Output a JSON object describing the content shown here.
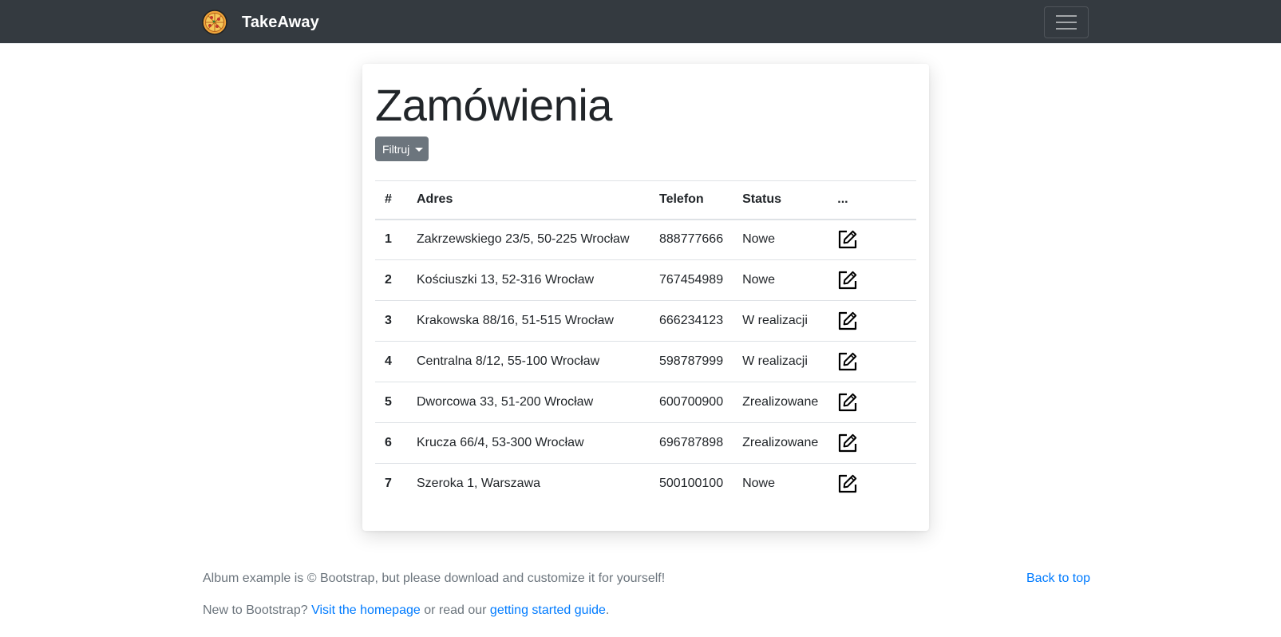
{
  "navbar": {
    "brand_name": "TakeAway",
    "logo_icon": "pizza-icon",
    "menu_icon": "hamburger-icon"
  },
  "main": {
    "title": "Zamówienia",
    "filter_button_label": "Filtruj",
    "table": {
      "headers": [
        "#",
        "Adres",
        "Telefon",
        "Status",
        "..."
      ],
      "rows": [
        {
          "num": "1",
          "address": "Zakrzewskiego 23/5, 50-225 Wrocław",
          "phone": "888777666",
          "status": "Nowe"
        },
        {
          "num": "2",
          "address": "Kościuszki 13, 52-316 Wrocław",
          "phone": "767454989",
          "status": "Nowe"
        },
        {
          "num": "3",
          "address": "Krakowska 88/16, 51-515 Wrocław",
          "phone": "666234123",
          "status": "W realizacji"
        },
        {
          "num": "4",
          "address": "Centralna 8/12, 55-100 Wrocław",
          "phone": "598787999",
          "status": "W realizacji"
        },
        {
          "num": "5",
          "address": "Dworcowa 33, 51-200 Wrocław",
          "phone": "600700900",
          "status": "Zrealizowane"
        },
        {
          "num": "6",
          "address": "Krucza 66/4, 53-300 Wrocław",
          "phone": "696787898",
          "status": "Zrealizowane"
        },
        {
          "num": "7",
          "address": "Szeroka 1, Warszawa",
          "phone": "500100100",
          "status": "Nowe"
        }
      ],
      "row_action_icon": "edit-icon"
    }
  },
  "footer": {
    "copyright_text": "Album example is © Bootstrap, but please download and customize it for yourself!",
    "back_to_top": "Back to top",
    "line2_prefix": "New to Bootstrap? ",
    "homepage_link": "Visit the homepage",
    "line2_middle": " or read our ",
    "guide_link": "getting started guide",
    "line2_suffix": "."
  },
  "colors": {
    "navbar_bg": "#343a40",
    "button_secondary": "#6c757d",
    "link": "#007bff"
  }
}
